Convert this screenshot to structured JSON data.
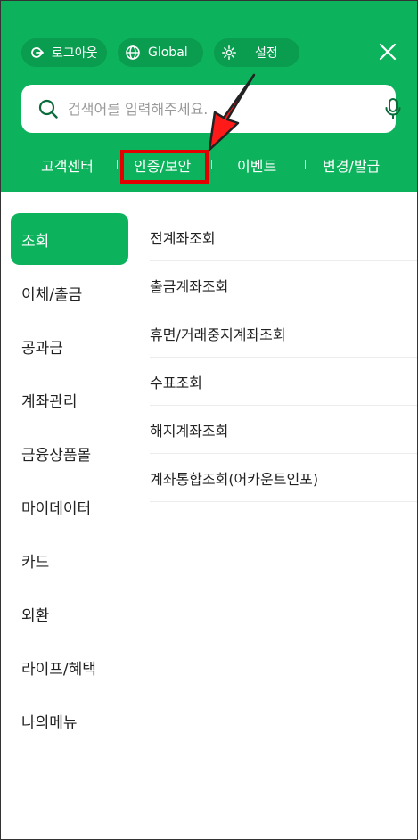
{
  "header": {
    "logout_label": "로그아웃",
    "global_label": "Global",
    "settings_label": "설정",
    "accent_color": "#0db35c"
  },
  "search": {
    "placeholder": "검색어를 입력해주세요.",
    "value": ""
  },
  "quick_links": [
    {
      "label": "고객센터"
    },
    {
      "label": "인증/보안"
    },
    {
      "label": "이벤트"
    },
    {
      "label": "변경/발급"
    }
  ],
  "sidebar": {
    "items": [
      {
        "label": "조회"
      },
      {
        "label": "이체/출금"
      },
      {
        "label": "공과금"
      },
      {
        "label": "계좌관리"
      },
      {
        "label": "금융상품몰"
      },
      {
        "label": "마이데이터"
      },
      {
        "label": "카드"
      },
      {
        "label": "외환"
      },
      {
        "label": "라이프/혜택"
      },
      {
        "label": "나의메뉴"
      }
    ]
  },
  "submenu": {
    "items": [
      {
        "label": "전계좌조회"
      },
      {
        "label": "출금계좌조회"
      },
      {
        "label": "휴면/거래중지계좌조회"
      },
      {
        "label": "수표조회"
      },
      {
        "label": "해지계좌조회"
      },
      {
        "label": "계좌통합조회(어카운트인포)"
      }
    ]
  },
  "annotation": {
    "highlight_color": "#e50000"
  }
}
